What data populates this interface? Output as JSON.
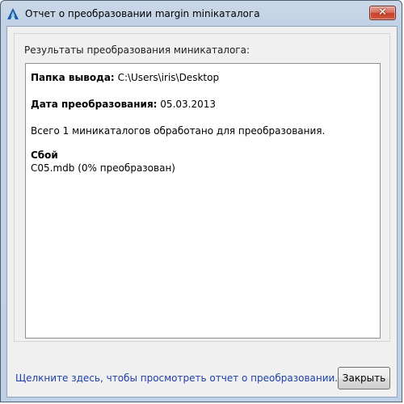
{
  "window": {
    "title": "Отчет о преобразовании margin miniкаталога"
  },
  "group": {
    "label": "Результаты преобразования миникаталога:"
  },
  "report": {
    "output_folder_label": "Папка вывода:",
    "output_folder_value": "C:\\Users\\iris\\Desktop",
    "date_label": "Дата преобразования:",
    "date_value": "05.03.2013",
    "summary": "Всего 1 миникаталогов обработано для преобразования.",
    "failure_heading": "Сбой",
    "failure_item": "C05.mdb (0% преобразован)"
  },
  "footer": {
    "link_text": "Щелкните здесь, чтобы просмотреть отчет о преобразовании.",
    "close_button_label": "Закрыть"
  },
  "colors": {
    "link": "#1c3fa8",
    "close_button": "#c4412c"
  }
}
